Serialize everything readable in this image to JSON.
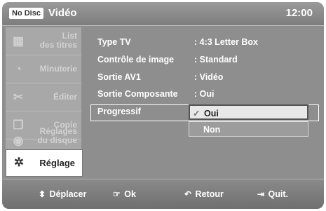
{
  "header": {
    "nodisc": "No Disc",
    "title": "Vidéo",
    "time": "12:00"
  },
  "sidebar": {
    "items": [
      {
        "label": "List\ndes titres",
        "icon": "film-icon"
      },
      {
        "label": "Minuterie",
        "icon": "timer-icon"
      },
      {
        "label": "Éditer",
        "icon": "scissors-icon"
      },
      {
        "label": "Copie",
        "icon": "copy-icon"
      },
      {
        "label": "Réglages\ndu disque",
        "icon": "disc-settings-icon"
      },
      {
        "label": "Réglage",
        "icon": "gear-icon"
      }
    ]
  },
  "settings": [
    {
      "key": "Type TV",
      "value": ": 4:3 Letter Box"
    },
    {
      "key": "Contrôle de image",
      "value": ": Standard"
    },
    {
      "key": "Sortie AV1",
      "value": ": Vidéo"
    },
    {
      "key": "Sortie Composante",
      "value": ": Oui"
    },
    {
      "key": "Progressif",
      "value": ""
    }
  ],
  "dropdown": {
    "options": [
      "Oui",
      "Non"
    ],
    "selected": "Oui",
    "check": "✓"
  },
  "footer": {
    "move": {
      "icon": "⬍",
      "label": "Déplacer"
    },
    "ok": {
      "icon": "☞",
      "label": "Ok"
    },
    "back": {
      "icon": "↶",
      "label": "Retour"
    },
    "quit": {
      "icon": "⇥",
      "label": "Quit."
    }
  }
}
